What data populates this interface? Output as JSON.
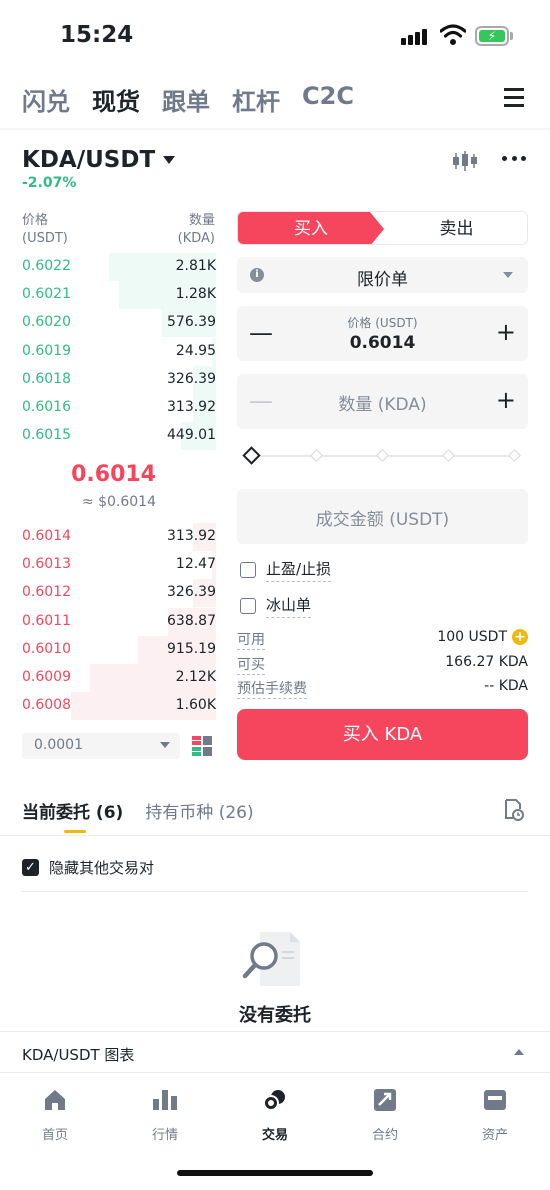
{
  "status": {
    "time": "15:24"
  },
  "top_tabs": [
    {
      "label": "闪兑",
      "active": false
    },
    {
      "label": "现货",
      "active": true
    },
    {
      "label": "跟单",
      "active": false
    },
    {
      "label": "杠杆",
      "active": false
    },
    {
      "label": "C2C",
      "active": false
    }
  ],
  "icons": {
    "menu": "menu-icon",
    "candle": "candlestick-icon",
    "more": "more-icon",
    "history": "order-history-icon"
  },
  "pair": {
    "symbol": "KDA/USDT",
    "change": "-2.07%"
  },
  "orderbook": {
    "header": {
      "price_label": "价格",
      "price_unit": "(USDT)",
      "qty_label": "数量",
      "qty_unit": "(KDA)"
    },
    "bids": [
      {
        "price": "0.6022",
        "qty": "2.81K",
        "depth": 0.55
      },
      {
        "price": "0.6021",
        "qty": "1.28K",
        "depth": 0.5
      },
      {
        "price": "0.6020",
        "qty": "576.39",
        "depth": 0.28
      },
      {
        "price": "0.6019",
        "qty": "24.95",
        "depth": 0.02
      },
      {
        "price": "0.6018",
        "qty": "326.39",
        "depth": 0.12
      },
      {
        "price": "0.6016",
        "qty": "313.92",
        "depth": 0.12
      },
      {
        "price": "0.6015",
        "qty": "449.01",
        "depth": 0.18
      }
    ],
    "mid_price": "0.6014",
    "mid_fiat": "≈ $0.6014",
    "asks": [
      {
        "price": "0.6014",
        "qty": "313.92",
        "depth": 0.12
      },
      {
        "price": "0.6013",
        "qty": "12.47",
        "depth": 0.02
      },
      {
        "price": "0.6012",
        "qty": "326.39",
        "depth": 0.12
      },
      {
        "price": "0.6011",
        "qty": "638.87",
        "depth": 0.25
      },
      {
        "price": "0.6010",
        "qty": "915.19",
        "depth": 0.4
      },
      {
        "price": "0.6009",
        "qty": "2.12K",
        "depth": 0.65
      },
      {
        "price": "0.6008",
        "qty": "1.60K",
        "depth": 0.75
      }
    ],
    "precision": "0.0001"
  },
  "form": {
    "buy_tab": "买入",
    "sell_tab": "卖出",
    "order_type": "限价单",
    "price_label": "价格 (USDT)",
    "price_value": "0.6014",
    "qty_placeholder": "数量 (KDA)",
    "amount_placeholder": "成交金额 (USDT)",
    "tpsl_label": "止盈/止损",
    "iceberg_label": "冰山单",
    "available_label": "可用",
    "available_value": "100 USDT",
    "can_buy_label": "可买",
    "can_buy_value": "166.27 KDA",
    "fee_label": "预估手续费",
    "fee_value": "-- KDA",
    "buy_button": "买入 KDA"
  },
  "orders": {
    "tab_open": "当前委托 (6)",
    "tab_holdings": "持有币种 (26)",
    "hide_others": "隐藏其他交易对",
    "empty": "没有委托"
  },
  "chart_bar": {
    "label": "KDA/USDT 图表"
  },
  "nav": [
    {
      "label": "首页",
      "icon": "home-icon",
      "active": false
    },
    {
      "label": "行情",
      "icon": "markets-icon",
      "active": false
    },
    {
      "label": "交易",
      "icon": "trade-icon",
      "active": true
    },
    {
      "label": "合约",
      "icon": "futures-icon",
      "active": false
    },
    {
      "label": "资产",
      "icon": "wallet-icon",
      "active": false
    }
  ],
  "colors": {
    "green": "#2ebd85",
    "red": "#f6465d",
    "yellow": "#f0b90b",
    "text": "#1e2329",
    "muted": "#707a8a"
  }
}
